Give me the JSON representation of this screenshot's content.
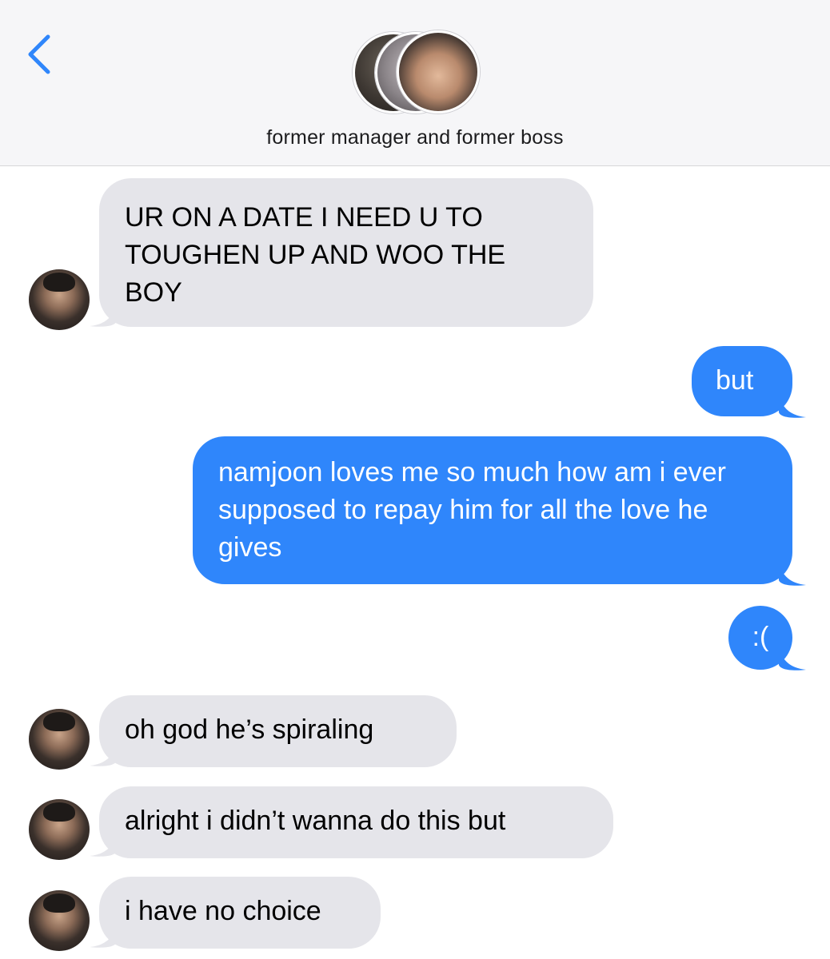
{
  "header": {
    "back_icon": "chevron-left-icon",
    "group_name": "former manager and former boss",
    "avatar_count": 3
  },
  "colors": {
    "incoming_bubble": "#e5e5ea",
    "outgoing_bubble": "#2f86fb",
    "back_tint": "#2f86fb"
  },
  "messages": [
    {
      "direction": "incoming",
      "text": "UR ON A DATE I NEED U TO TOUGHEN UP AND WOO THE BOY"
    },
    {
      "direction": "outgoing",
      "text": "but"
    },
    {
      "direction": "outgoing",
      "text": "namjoon loves me so much how am i ever supposed to repay him for all the love he gives"
    },
    {
      "direction": "outgoing",
      "text": ":("
    },
    {
      "direction": "incoming",
      "text": "oh god he’s spiraling"
    },
    {
      "direction": "incoming",
      "text": "alright i didn’t wanna do this but"
    },
    {
      "direction": "incoming",
      "text": "i have no choice"
    }
  ]
}
